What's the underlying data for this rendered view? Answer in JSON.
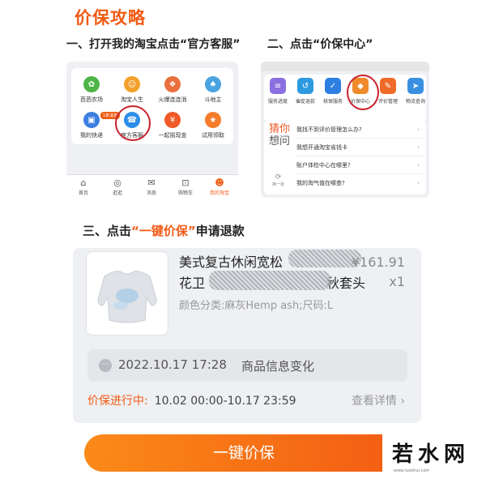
{
  "title": "价保攻略",
  "steps": {
    "step1": "一、打开我的淘宝点击“官方客服”",
    "step2": "二、点击“价保中心”",
    "step3_prefix": "三、点击",
    "step3_highlight": "“一键价保”",
    "step3_suffix": "申请退款"
  },
  "panel1": {
    "items": [
      {
        "label": "芭芭农场",
        "icon": "farm-icon",
        "color": "#4fb548",
        "glyph": "✿"
      },
      {
        "label": "淘宝人生",
        "icon": "life-icon",
        "color": "#f3a02a",
        "glyph": "☺"
      },
      {
        "label": "火爆连连消",
        "icon": "game-icon",
        "color": "#e9703c",
        "glyph": "❖"
      },
      {
        "label": "斗地主",
        "icon": "cards-icon",
        "color": "#4aa3e0",
        "glyph": "♠"
      },
      {
        "label": "我的快递",
        "icon": "delivery-icon",
        "color": "#3b7fe0",
        "glyph": "▣"
      },
      {
        "label": "官方客服",
        "icon": "service-icon",
        "color": "#2d8ee8",
        "glyph": "☎"
      },
      {
        "label": "一起摇现金",
        "icon": "cash-icon",
        "color": "#f05a28",
        "glyph": "¥"
      },
      {
        "label": "试用领取",
        "icon": "trial-icon",
        "color": "#f57c2a",
        "glyph": "★"
      }
    ],
    "badge": "1条消息",
    "tabs": [
      {
        "label": "首页",
        "icon": "home-icon",
        "glyph": "⌂"
      },
      {
        "label": "逛逛",
        "icon": "explore-icon",
        "glyph": "◎"
      },
      {
        "label": "消息",
        "icon": "message-icon",
        "glyph": "✉"
      },
      {
        "label": "购物车",
        "icon": "cart-icon",
        "glyph": "⊡"
      },
      {
        "label": "我的淘宝",
        "icon": "profile-icon",
        "glyph": "☻"
      }
    ]
  },
  "panel2": {
    "buttons": [
      {
        "label": "服务进度",
        "icon": "progress-icon",
        "color": "#8b6fe0",
        "glyph": "≡"
      },
      {
        "label": "催促退款",
        "icon": "refund-icon",
        "color": "#2d9ae0",
        "glyph": "↺"
      },
      {
        "label": "核保服务",
        "icon": "insurance-icon",
        "color": "#2d7fe0",
        "glyph": "✓"
      },
      {
        "label": "价保中心",
        "icon": "price-protect-icon",
        "color": "#f08a2a",
        "glyph": "◆"
      },
      {
        "label": "评价管理",
        "icon": "review-icon",
        "color": "#f06a2a",
        "glyph": "✎"
      },
      {
        "label": "物流查询",
        "icon": "logistics-icon",
        "color": "#3a8fe0",
        "glyph": "➤"
      }
    ],
    "guess_line1": "猜你",
    "guess_line2": "想问",
    "swap_label": "换一批",
    "faqs": [
      "我找不到评价管理怎么办?",
      "我想开通淘宝省钱卡",
      "账户体检中心在哪里?",
      "我的淘气值在哪查?"
    ]
  },
  "order": {
    "name_line1": "美式复古休闲宽松",
    "name_line2_a": "花卫",
    "name_line2_b": "秋套头",
    "sku": "颜色分类:麻灰Hemp ash;尺码:L",
    "price": "¥161.91",
    "quantity": "x1",
    "notice_time": "2022.10.17 17:28",
    "notice_label": "商品信息变化",
    "status_label": "价保进行中:",
    "status_range": "10.02 00:00-10.17 23:59",
    "details_link": "查看详情 ›"
  },
  "cta_label": "一键价保",
  "watermark": {
    "text": "若水网",
    "sub": "www.ruoshui.com"
  },
  "colors": {
    "accent": "#f15a13",
    "highlight_circle": "#c8202a"
  }
}
